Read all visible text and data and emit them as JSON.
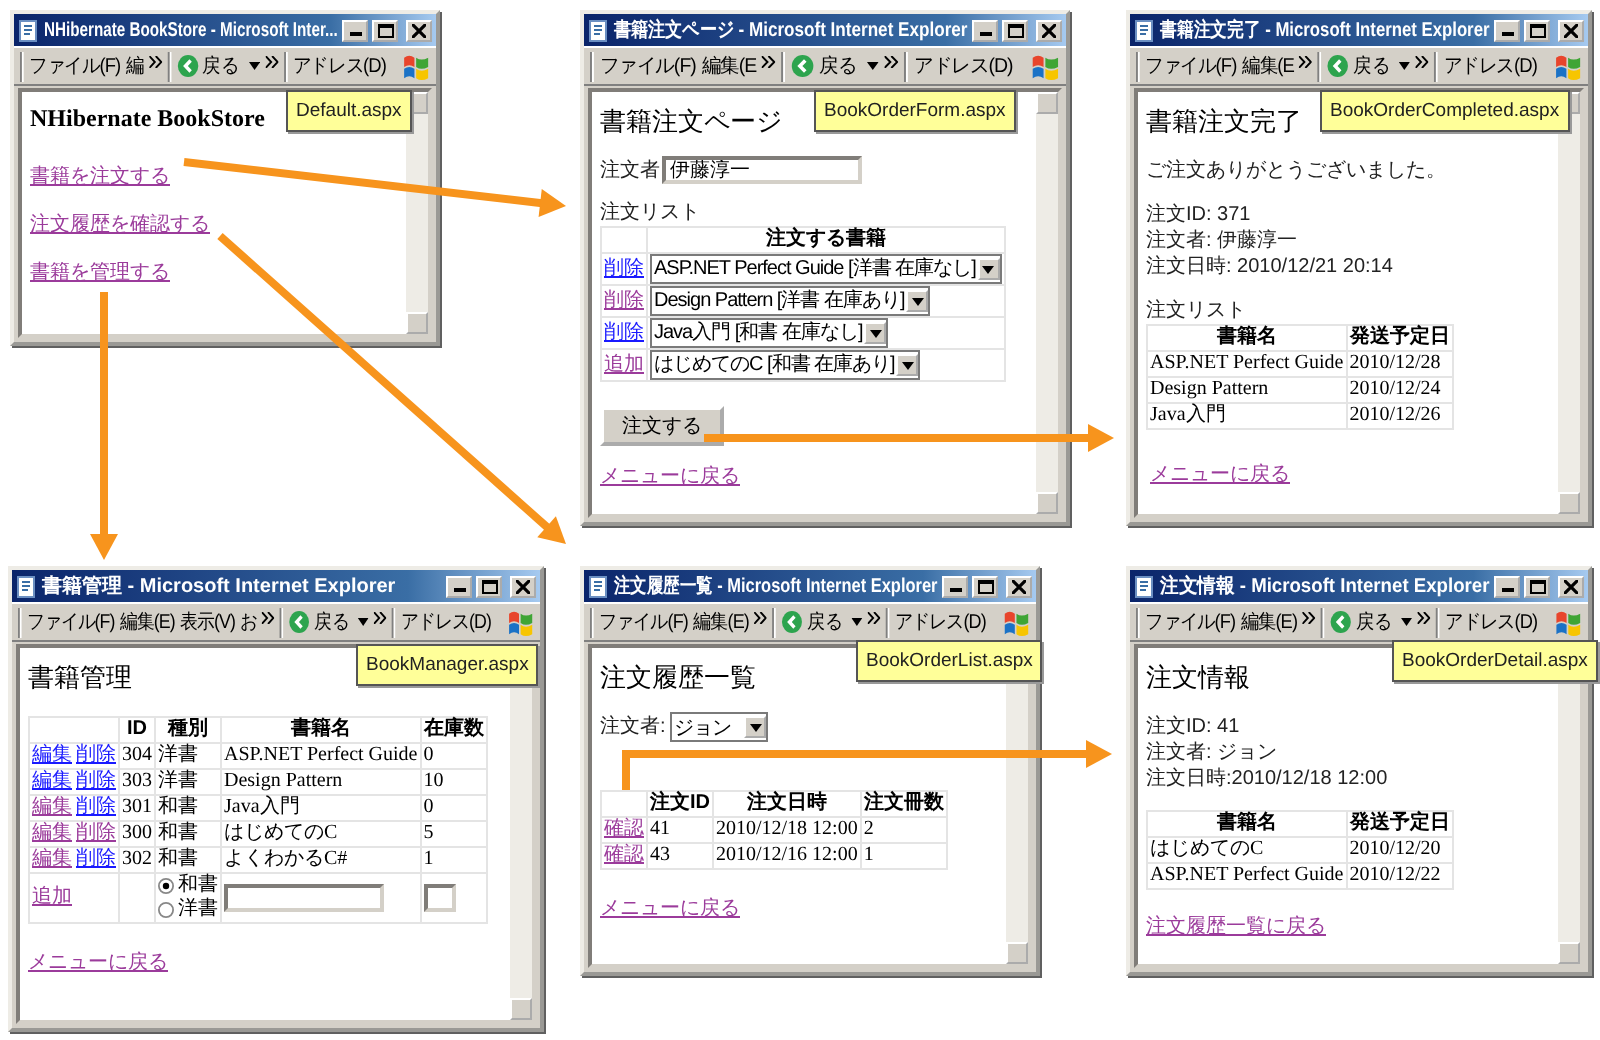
{
  "windows": [
    {
      "kind": "menu",
      "title": "NHibernate BookStore - Microsoft Inter...",
      "menus": [
        "ファイル(F)",
        "編"
      ],
      "back": "戻る",
      "address": "アドレス(D)",
      "file_label": "Default.aspx",
      "heading": "NHibernate BookStore",
      "links": [
        "書籍を注文する",
        "注文履歴を確認する",
        "書籍を管理する"
      ]
    },
    {
      "kind": "order_form",
      "title": "書籍注文ページ - Microsoft Internet Explorer",
      "menus": [
        "ファイル(F)",
        "編集(E"
      ],
      "back": "戻る",
      "address": "アドレス(D)",
      "file_label": "BookOrderForm.aspx",
      "heading": "書籍注文ページ",
      "orderer_label": "注文者",
      "orderer_value": "伊藤淳一",
      "list_label": "注文リスト",
      "column": "注文する書籍",
      "rows": [
        {
          "action": "削除",
          "visited": false,
          "book": "ASP.NET Perfect Guide [洋書 在庫なし]"
        },
        {
          "action": "削除",
          "visited": true,
          "book": "Design Pattern [洋書 在庫あり]"
        },
        {
          "action": "削除",
          "visited": false,
          "book": "Java入門 [和書 在庫なし]"
        },
        {
          "action": "追加",
          "visited": true,
          "book": "はじめてのC [和書 在庫あり]"
        }
      ],
      "submit": "注文する",
      "back_link": "メニューに戻る"
    },
    {
      "kind": "order_completed",
      "title": "書籍注文完了 - Microsoft Internet Explorer",
      "menus": [
        "ファイル(F)",
        "編集(E"
      ],
      "back": "戻る",
      "address": "アドレス(D)",
      "file_label": "BookOrderCompleted.aspx",
      "heading": "書籍注文完了",
      "message": "ご注文ありがとうございました。",
      "details": [
        "注文ID: 371",
        "注文者: 伊藤淳一",
        "注文日時: 2010/12/21 20:14"
      ],
      "list_label": "注文リスト",
      "columns": [
        "書籍名",
        "発送予定日"
      ],
      "rows": [
        [
          "ASP.NET Perfect Guide",
          "2010/12/28"
        ],
        [
          "Design Pattern",
          "2010/12/24"
        ],
        [
          "Java入門",
          "2010/12/26"
        ]
      ],
      "back_link": "メニューに戻る"
    },
    {
      "kind": "manager",
      "title": "書籍管理 - Microsoft Internet Explorer",
      "menus": [
        "ファイル(F)",
        "編集(E)",
        "表示(V)",
        "お"
      ],
      "back": "戻る",
      "address": "アドレス(D)",
      "file_label": "BookManager.aspx",
      "heading": "書籍管理",
      "columns": [
        "ID",
        "種別",
        "書籍名",
        "在庫数"
      ],
      "rows": [
        {
          "edit": "編集",
          "edit_visited": false,
          "delete": "削除",
          "delete_visited": false,
          "id": "304",
          "type": "洋書",
          "name": "ASP.NET Perfect Guide",
          "stock": "0"
        },
        {
          "edit": "編集",
          "edit_visited": false,
          "delete": "削除",
          "delete_visited": false,
          "id": "303",
          "type": "洋書",
          "name": "Design Pattern",
          "stock": "10"
        },
        {
          "edit": "編集",
          "edit_visited": true,
          "delete": "削除",
          "delete_visited": false,
          "id": "301",
          "type": "和書",
          "name": "Java入門",
          "stock": "0"
        },
        {
          "edit": "編集",
          "edit_visited": true,
          "delete": "削除",
          "delete_visited": true,
          "id": "300",
          "type": "和書",
          "name": "はじめてのC",
          "stock": "5"
        },
        {
          "edit": "編集",
          "edit_visited": true,
          "delete": "削除",
          "delete_visited": false,
          "id": "302",
          "type": "和書",
          "name": "よくわかるC#",
          "stock": "1"
        }
      ],
      "add_link": "追加",
      "type_options": [
        {
          "label": "和書",
          "selected": true
        },
        {
          "label": "洋書",
          "selected": false
        }
      ],
      "back_link": "メニューに戻る"
    },
    {
      "kind": "order_list",
      "title": "注文履歴一覧 - Microsoft Internet Explorer",
      "menus": [
        "ファイル(F)",
        "編集(E)"
      ],
      "back": "戻る",
      "address": "アドレス(D)",
      "file_label": "BookOrderList.aspx",
      "heading": "注文履歴一覧",
      "orderer_label": "注文者:",
      "orderer_value": "ジョン",
      "columns": [
        "注文ID",
        "注文日時",
        "注文冊数"
      ],
      "rows": [
        {
          "action": "確認",
          "id": "41",
          "date": "2010/12/18 12:00",
          "count": "2"
        },
        {
          "action": "確認",
          "id": "43",
          "date": "2010/12/16 12:00",
          "count": "1"
        }
      ],
      "back_link": "メニューに戻る"
    },
    {
      "kind": "order_detail",
      "title": "注文情報 - Microsoft Internet Explorer",
      "menus": [
        "ファイル(F)",
        "編集(E)"
      ],
      "back": "戻る",
      "address": "アドレス(D)",
      "file_label": "BookOrderDetail.aspx",
      "heading": "注文情報",
      "details": [
        "注文ID: 41",
        "注文者: ジョン",
        "注文日時:2010/12/18 12:00"
      ],
      "columns": [
        "書籍名",
        "発送予定日"
      ],
      "rows": [
        [
          "はじめてのC",
          "2010/12/20"
        ],
        [
          "ASP.NET Perfect Guide",
          "2010/12/22"
        ]
      ],
      "back_link": "注文履歴一覧に戻る"
    }
  ]
}
